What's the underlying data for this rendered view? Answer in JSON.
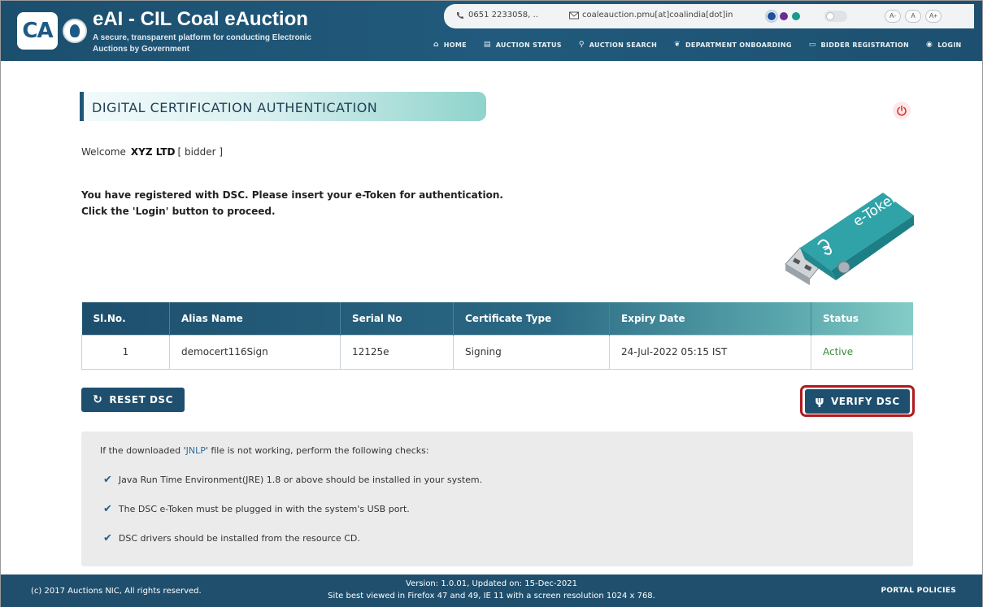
{
  "header": {
    "title": "eAI - CIL Coal eAuction",
    "subtitle": "A secure, transparent platform for conducting Electronic Auctions by Government",
    "logo_text": "CA",
    "phone": "0651 2233058, ..",
    "email": "coaleauction.pmu[at]coalindia[dot]in",
    "theme_colors": [
      "#1f4f9e",
      "#6a2d8f",
      "#1a9a8a"
    ],
    "font_buttons": [
      "A-",
      "A",
      "A+"
    ],
    "nav": [
      {
        "label": "HOME",
        "icon": "home-icon"
      },
      {
        "label": "AUCTION STATUS",
        "icon": "status-icon"
      },
      {
        "label": "AUCTION SEARCH",
        "icon": "search-icon"
      },
      {
        "label": "DEPARTMENT ONBOARDING",
        "icon": "leaf-icon"
      },
      {
        "label": "BIDDER REGISTRATION",
        "icon": "id-card-icon"
      },
      {
        "label": "LOGIN",
        "icon": "user-icon"
      }
    ]
  },
  "main": {
    "section_title": "DIGITAL CERTIFICATION AUTHENTICATION",
    "welcome_label": "Welcome",
    "user_name": "XYZ LTD",
    "user_role": "[ bidder ]",
    "instruction_1": "You have registered with DSC. Please insert your e-Token for authentication.",
    "instruction_2": "Click the 'Login' button to proceed.",
    "token_label": "e-Token",
    "table": {
      "headers": [
        "Sl.No.",
        "Alias Name",
        "Serial No",
        "Certificate Type",
        "Expiry Date",
        "Status"
      ],
      "rows": [
        {
          "sl": "1",
          "alias": "democert116Sign",
          "serial": "12125e",
          "type": "Signing",
          "expiry": "24-Jul-2022 05:15 IST",
          "status": "Active"
        }
      ]
    },
    "reset_label": "RESET DSC",
    "verify_label": "VERIFY DSC",
    "checks": {
      "head_pre": "If the downloaded '",
      "head_link": "JNLP",
      "head_post": "' file is not working, perform the following checks:",
      "items": [
        "Java Run Time Environment(JRE) 1.8 or above should be installed in your system.",
        "The DSC e-Token must be plugged in with the system's USB port.",
        "DSC drivers should be installed from the resource CD."
      ]
    }
  },
  "footer": {
    "copyright": "(c) 2017 Auctions NIC, All rights reserved.",
    "version": "Version: 1.0.01, Updated on: 15-Dec-2021",
    "best_viewed": "Site best viewed in Firefox 47 and 49, IE 11 with a screen resolution 1024 x 768.",
    "policies": "PORTAL POLICIES"
  },
  "colors": {
    "header_bg": "#1f4f6d",
    "accent_red": "#b0191e",
    "status_active": "#3a8a3a",
    "teal": "#84ccc6"
  }
}
